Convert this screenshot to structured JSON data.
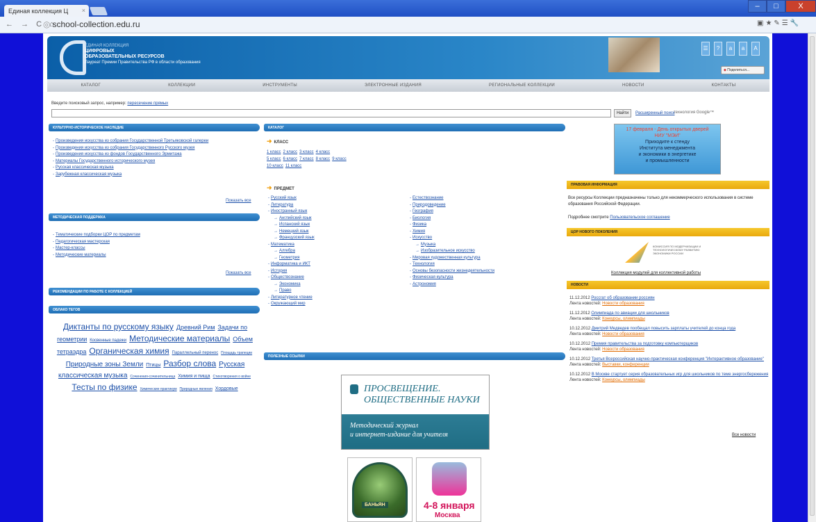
{
  "browser": {
    "tab_title": "Единая коллекция Ц",
    "tab_close": "×",
    "url": "school-collection.edu.ru",
    "nav_glyphs": "← → C ⌂",
    "tools_glyphs": "▣★✎☰🔧",
    "win_min": "–",
    "win_max": "□",
    "win_close": "X"
  },
  "header": {
    "brand_line1": "ЕДИНАЯ КОЛЛЕКЦИЯ",
    "brand_line2": "ЦИФРОВЫХ",
    "brand_line3": "ОБРАЗОВАТЕЛЬНЫХ РЕСУРСОВ",
    "brand_line4": "Лауреат Премии Правительства РФ в области образования",
    "share_label": "Поделиться...",
    "icons": [
      "☰",
      "?",
      "a",
      "a",
      "A"
    ]
  },
  "menu": [
    "КАТАЛОГ",
    "КОЛЛЕКЦИИ",
    "ИНСТРУМЕНТЫ",
    "ЭЛЕКТРОННЫЕ ИЗДАНИЯ",
    "РЕГИОНАЛЬНЫЕ КОЛЛЕКЦИИ",
    "НОВОСТИ",
    "КОНТАКТЫ"
  ],
  "search": {
    "prompt": "Введите поисковый запрос, например:",
    "example": "пересечение прямых",
    "button": "Найти",
    "advanced": "Расширенный поиск",
    "tech": "технология Google™"
  },
  "left": {
    "heritage_title": "КУЛЬТУРНО-ИСТОРИЧЕСКОЕ НАСЛЕДИЕ",
    "heritage": [
      "Произведения искусства из собрания Государственной Третьяковской галереи",
      "Произведения искусства из собрания Государственного Русского музея",
      "Произведения искусства из фондов Государственного Эрмитажа",
      "Материалы Государственного исторического музея",
      "Русская классическая музыка",
      "Зарубежная классическая музыка"
    ],
    "show_all": "Показать все",
    "method_title": "МЕТОДИЧЕСКАЯ ПОДДЕРЖКА",
    "method": [
      "Тематические подборки ЦОР по предметам",
      "Педагогическая мастерская",
      "Мастер-классы",
      "Методические материалы"
    ],
    "recommend_title": "РЕКОМЕНДАЦИИ ПО РАБОТЕ С КОЛЛЕКЦИЕЙ",
    "cloud_title": "ОБЛАКО ТЕГОВ",
    "cloud": [
      {
        "t": "Диктанты по русскому языку",
        "s": 12
      },
      {
        "t": "Древний Рим",
        "s": 9
      },
      {
        "t": "Задачи по геометрии",
        "s": 9
      },
      {
        "t": "Косвенные падежи",
        "s": 6
      },
      {
        "t": "Методические материалы",
        "s": 12
      },
      {
        "t": "Объем тетраэдра",
        "s": 9
      },
      {
        "t": "Органическая химия",
        "s": 12
      },
      {
        "t": "Параллельный перенос",
        "s": 6
      },
      {
        "t": "Площадь трапеции",
        "s": 5
      },
      {
        "t": "Природные зоны Земли",
        "s": 10
      },
      {
        "t": "Птицы",
        "s": 7
      },
      {
        "t": "Разбор слова",
        "s": 12
      },
      {
        "t": "Русская классическая музыка",
        "s": 10
      },
      {
        "t": "Сочинения-сочинительница",
        "s": 5
      },
      {
        "t": "Химия и пища",
        "s": 7
      },
      {
        "t": "Стихотворения о войне",
        "s": 5
      },
      {
        "t": "Тесты по физике",
        "s": 12
      },
      {
        "t": "Химические практикум",
        "s": 5
      },
      {
        "t": "Природные явления",
        "s": 5
      },
      {
        "t": "Хордовые",
        "s": 7
      }
    ]
  },
  "center": {
    "catalog_title": "КАТАЛОГ",
    "class_head": "КЛАСС",
    "grades": [
      "1 класс",
      "2 класс",
      "3 класс",
      "4 класс",
      "5 класс",
      "6 класс",
      "7 класс",
      "8 класс",
      "9 класс",
      "10 класс",
      "11 класс"
    ],
    "subject_head": "ПРЕДМЕТ",
    "subjects_left": [
      {
        "t": "Русский язык",
        "l": 0
      },
      {
        "t": "Литература",
        "l": 0
      },
      {
        "t": "Иностранный язык",
        "l": 0
      },
      {
        "t": "Английский язык",
        "l": 1
      },
      {
        "t": "Испанский язык",
        "l": 1
      },
      {
        "t": "Немецкий язык",
        "l": 1
      },
      {
        "t": "Французский язык",
        "l": 1
      },
      {
        "t": "Математика",
        "l": 0
      },
      {
        "t": "Алгебра",
        "l": 1
      },
      {
        "t": "Геометрия",
        "l": 1
      },
      {
        "t": "Информатика и ИКТ",
        "l": 0
      },
      {
        "t": "История",
        "l": 0
      },
      {
        "t": "Обществознание",
        "l": 0
      },
      {
        "t": "Экономика",
        "l": 1
      },
      {
        "t": "Право",
        "l": 1
      },
      {
        "t": "Литературное чтение",
        "l": 0
      },
      {
        "t": "Окружающий мир",
        "l": 0
      }
    ],
    "subjects_right": [
      {
        "t": "Естествознание",
        "l": 0
      },
      {
        "t": "Природоведение",
        "l": 0
      },
      {
        "t": "География",
        "l": 0
      },
      {
        "t": "Биология",
        "l": 0
      },
      {
        "t": "Физика",
        "l": 0
      },
      {
        "t": "Химия",
        "l": 0
      },
      {
        "t": "Искусство",
        "l": 0
      },
      {
        "t": "Музыка",
        "l": 1
      },
      {
        "t": "Изобразительное искусство",
        "l": 1
      },
      {
        "t": "Мировая художественная культура",
        "l": 0
      },
      {
        "t": "Технология",
        "l": 0
      },
      {
        "t": "Основы безопасности жизнедеятельности",
        "l": 0
      },
      {
        "t": "Физическая культура",
        "l": 0
      },
      {
        "t": "Астрономия",
        "l": 0
      }
    ],
    "links_title": "ПОЛЕЗНЫЕ ССЫЛКИ",
    "prosv_line1": "ПРОСВЕЩЕНИЕ.",
    "prosv_line2": "ОБЩЕСТВЕННЫЕ НАУКИ",
    "prosv_line3": "Методический журнал",
    "prosv_line4": "и интернет-издание для учителя",
    "banyan": "БАНЬЯН",
    "jan_line1": "4-8 января",
    "jan_line2": "Москва"
  },
  "right": {
    "banner_line1": "17 февраля - День открытых дверей",
    "banner_line2": "НИУ \"МЭИ\"",
    "banner_line3": "Приходите к стенду",
    "banner_line4": "Института менеджмента",
    "banner_line5": "и экономики в энергетике",
    "banner_line6": "и промышленности",
    "legal_title": "ПРАВОВАЯ ИНФОРМАЦИЯ",
    "legal_text": "Все ресурсы Коллекции предназначены только для некоммерческого использования в системе образования Российской Федерации.",
    "legal_more": "Подробнее смотрите",
    "legal_link": "Пользовательское соглашение",
    "dor_title": "ЦОР НОВОГО ПОКОЛЕНИЯ",
    "kom_text": "КОМИССИЯ ПО МОДЕРНИЗАЦИИ И ТЕХНОЛОГИЧЕСКОМУ РАЗВИТИЮ ЭКОНОМИКИ РОССИИ",
    "dor_link": "Коллекция модулей для коллективной работы",
    "news_title": "НОВОСТИ",
    "news_feed_label": "Лента новостей:",
    "news": [
      {
        "d": "11.12.2012",
        "t": "Россгат об образовании россиян",
        "c": "Новости образования"
      },
      {
        "d": "11.12.2012",
        "t": "Олимпиада по авиации для школьников",
        "c": "Конкурсы, олимпиады"
      },
      {
        "d": "10.12.2012",
        "t": "Дмитрий Медведев пообещал повысить зарплаты учителей до конца года",
        "c": "Новости образования"
      },
      {
        "d": "10.12.2012",
        "t": "Премия правительства за подготовку компьютерщиков",
        "c": "Новости образования"
      },
      {
        "d": "10.12.2012",
        "t": "Третья Всероссийская научно-практическая конференция \"Интерактивное образование\"",
        "c": "Выставки, конференции"
      },
      {
        "d": "10.12.2012",
        "t": "В Москве стартует серия образовательных игр для школьников по теме энергосбережения",
        "c": "Конкурсы, олимпиады"
      }
    ],
    "all_news": "Все новости"
  }
}
